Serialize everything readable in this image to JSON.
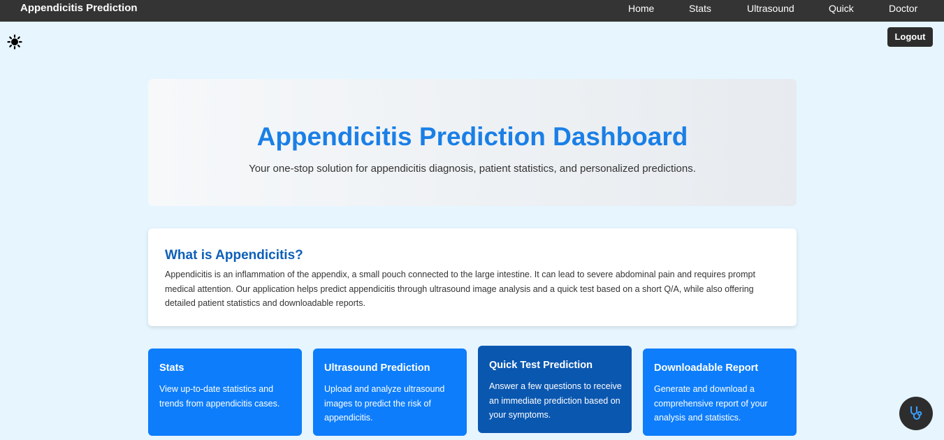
{
  "navbar": {
    "brand": "Appendicitis Prediction",
    "links": [
      "Home",
      "Stats",
      "Ultrasound",
      "Quick",
      "Doctor"
    ]
  },
  "header": {
    "theme_icon": "sun-icon",
    "logout_label": "Logout"
  },
  "hero": {
    "title": "Appendicitis Prediction Dashboard",
    "subtitle": "Your one-stop solution for appendicitis diagnosis, patient statistics, and personalized predictions."
  },
  "about": {
    "title": "What is Appendicitis?",
    "body": "Appendicitis is an inflammation of the appendix, a small pouch connected to the large intestine. It can lead to severe abdominal pain and requires prompt medical attention. Our application helps predict appendicitis through ultrasound image analysis and a quick test based on a short Q/A, while also offering detailed patient statistics and downloadable reports."
  },
  "cards": [
    {
      "title": "Stats",
      "description": "View up-to-date statistics and trends from appendicitis cases."
    },
    {
      "title": "Ultrasound Prediction",
      "description": "Upload and analyze ultrasound images to predict the risk of appendicitis."
    },
    {
      "title": "Quick Test Prediction",
      "description": "Answer a few questions to receive an immediate prediction based on your symptoms."
    },
    {
      "title": "Downloadable Report",
      "description": "Generate and download a comprehensive report of your analysis and statistics."
    }
  ],
  "fab": {
    "icon": "stethoscope-icon"
  },
  "colors": {
    "navbar": "#343434",
    "page_background": "#e6f5fe",
    "accent": "#1a7fe6",
    "card": "#0d7dfb",
    "card_active": "#0a57b0"
  }
}
